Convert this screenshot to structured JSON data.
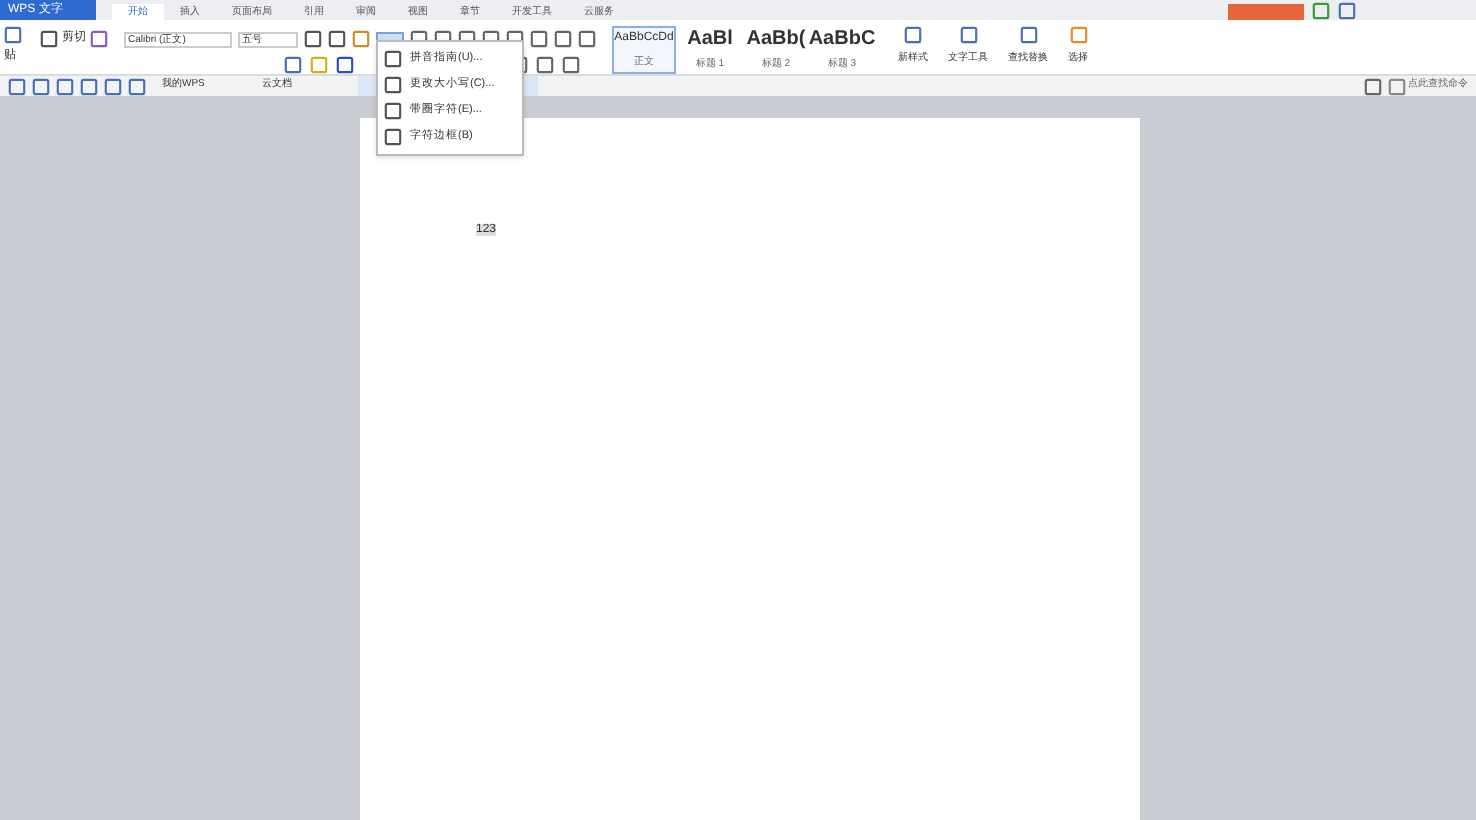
{
  "app_button": {
    "label": "WPS 文字"
  },
  "menu_tabs": [
    {
      "label": "开始",
      "selected": true
    },
    {
      "label": "插入",
      "selected": false
    },
    {
      "label": "页面布局",
      "selected": false
    },
    {
      "label": "引用",
      "selected": false
    },
    {
      "label": "审阅",
      "selected": false
    },
    {
      "label": "视图",
      "selected": false
    },
    {
      "label": "章节",
      "selected": false
    },
    {
      "label": "开发工具",
      "selected": false
    },
    {
      "label": "云服务",
      "selected": false
    }
  ],
  "ribbon": {
    "paste": "贴",
    "cut": "剪切",
    "font": "Calibri (正文)",
    "size": "五号",
    "styles": [
      {
        "sample": "AaBbCcDd",
        "label": "正文",
        "selected": true
      },
      {
        "sample": "AaBl",
        "label": "标题 1",
        "selected": false
      },
      {
        "sample": "AaBb(",
        "label": "标题 2",
        "selected": false
      },
      {
        "sample": "AaBbC",
        "label": "标题 3",
        "selected": false
      }
    ],
    "tools": [
      "新样式",
      "文字工具",
      "查找替换",
      "选择"
    ]
  },
  "dropdown_menu": [
    {
      "label": "拼音指南(U)..."
    },
    {
      "label": "更改大小写(C)..."
    },
    {
      "label": "带圈字符(E)..."
    },
    {
      "label": "字符边框(B)"
    }
  ],
  "doc_tabs": [
    {
      "label": "我的WPS",
      "selected": false
    },
    {
      "label": "云文档",
      "selected": false
    },
    {
      "selected": true
    }
  ],
  "search": {
    "placeholder": "点此查找命令"
  },
  "document": {
    "text": "123"
  }
}
